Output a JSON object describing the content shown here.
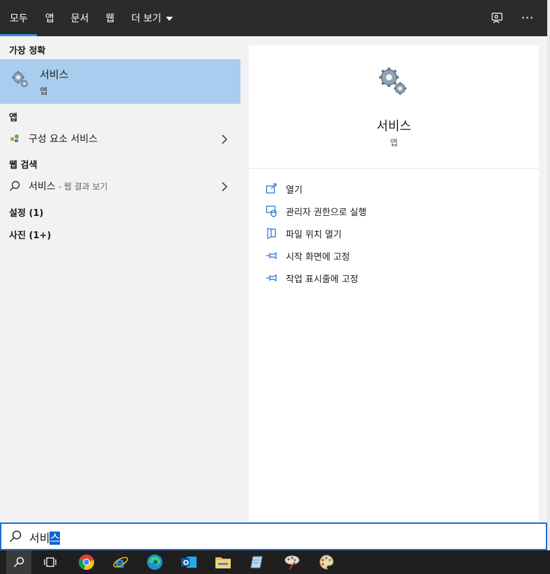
{
  "tabs": [
    {
      "label": "모두",
      "active": true
    },
    {
      "label": "앱",
      "active": false
    },
    {
      "label": "문서",
      "active": false
    },
    {
      "label": "웹",
      "active": false
    },
    {
      "label": "더 보기",
      "active": false,
      "dropdown": true
    }
  ],
  "top_icons": [
    "feedback-icon",
    "more-options-icon"
  ],
  "left": {
    "best_match_header": "가장 정확",
    "best_match": {
      "title": "서비스",
      "subtitle": "앱",
      "icon": "gear-icon"
    },
    "apps_header": "앱",
    "apps": [
      {
        "label": "구성 요소 서비스",
        "icon": "component-services-icon"
      }
    ],
    "web_header": "웹 검색",
    "web": [
      {
        "label": "서비스",
        "suffix": " - 웹 결과 보기",
        "icon": "search-icon"
      }
    ],
    "settings_header": "설정 (1)",
    "photos_header": "사진 (1+)"
  },
  "right": {
    "title": "서비스",
    "subtitle": "앱",
    "actions": [
      {
        "label": "열기",
        "icon": "open-icon"
      },
      {
        "label": "관리자 권한으로 실행",
        "icon": "run-as-admin-icon"
      },
      {
        "label": "파일 위치 열기",
        "icon": "file-location-icon"
      },
      {
        "label": "시작 화면에 고정",
        "icon": "pin-start-icon"
      },
      {
        "label": "작업 표시줄에 고정",
        "icon": "pin-taskbar-icon"
      }
    ]
  },
  "search": {
    "typed": "서비",
    "selected": "스"
  },
  "taskbar": [
    "search-icon",
    "task-view-icon",
    "chrome-icon",
    "ie-icon",
    "edge-icon",
    "outlook-icon",
    "file-explorer-icon",
    "notepad-icon",
    "paint-icon",
    "palette-icon"
  ],
  "colors": {
    "accent": "#1b6fd1",
    "selected_row": "#a9cdee",
    "topbar": "#2b2b2b",
    "taskbar": "#1f1f1f"
  }
}
